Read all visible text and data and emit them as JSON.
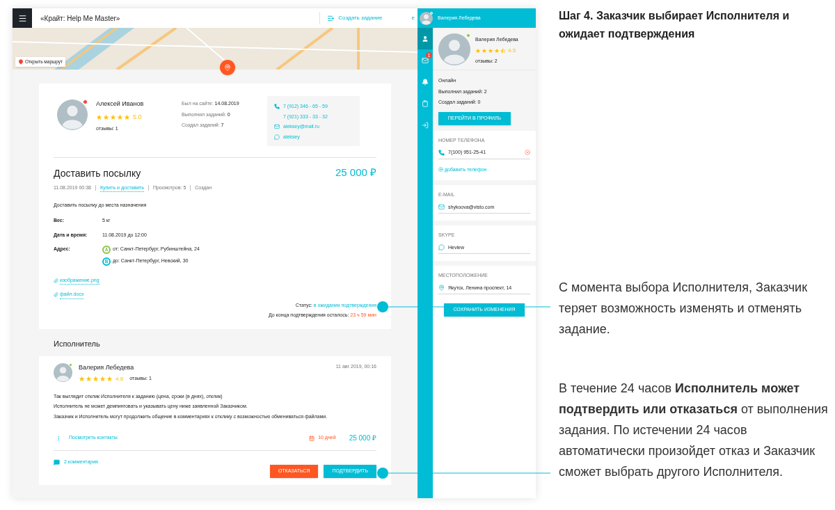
{
  "header": {
    "title": "«Крайт: Help Me Master»",
    "create_task": "Создать задание",
    "cut_link": "e"
  },
  "map": {
    "route_button": "Открыть маршрут"
  },
  "customer": {
    "name": "Алексей Иванов",
    "online": false,
    "stars": 5,
    "rating": "5.0",
    "reviews": "отзывы: 1",
    "stats": [
      {
        "label": "Был на сайте:",
        "value": "14.08.2019"
      },
      {
        "label": "Выполнил заданий:",
        "value": "0"
      },
      {
        "label": "Создал заданий:",
        "value": "7"
      }
    ],
    "phones": [
      "7 (912) 346 - 65 - 59",
      "7 (921) 333 - 33 - 32"
    ],
    "email": "aleksey@mall.ru",
    "skype": "aleksey"
  },
  "task": {
    "title": "Доставить посылку",
    "price": "25 000 ₽",
    "date": "11.08.2019 00:38",
    "category": "Купить и доставить",
    "views": "Просмотров: 5",
    "state": "Создан",
    "description": "Доставить посылку до места назначения",
    "details": [
      {
        "label": "Вес:",
        "value": "5 кг"
      },
      {
        "label": "Дата и время:",
        "value": "11.08.2019 до 12:00"
      }
    ],
    "address_label": "Адрес:",
    "addresses": [
      {
        "marker": "A",
        "text": "от: Санкт-Петербург, Рубинштейна, 24",
        "color": "#8bc34a"
      },
      {
        "marker": "B",
        "text": "до: Санкт-Петербург, Невский, 30",
        "color": "#00bcd4"
      }
    ],
    "attachments": [
      "изображение.png",
      "файл.docx"
    ],
    "status_label": "Статус:",
    "status_value": "в ожидании подтверждения",
    "remaining_label": "До конца подтверждения осталось:",
    "remaining_value": "23 ч 59 мин"
  },
  "executor_heading": "Исполнитель",
  "response": {
    "name": "Валерия Лебедева",
    "online": true,
    "stars": 5,
    "rating": "4.8",
    "reviews": "отзывы: 1",
    "date": "11 авг 2019, 00:16",
    "lines": [
      "Так выглядит отклик Исполнителя к заданию (цена, сроки (в днях), отклик)",
      "Исполнитель не может демпинговать и указывать цену ниже заявленной Заказчиком.",
      "Заказчик и Исполнитель могут продолжить общение в комментариях к отклику с возможностью обмениваться файлами."
    ],
    "contacts_link": "Посмотреть контакты",
    "days": "10 дней",
    "price": "25 000 ₽",
    "comments": "2 комментария",
    "buttons": [
      {
        "label": "ОТКАЗАТЬСЯ",
        "kind": "decline"
      },
      {
        "label": "ПОДТВЕРДИТЬ",
        "kind": "confirm"
      }
    ]
  },
  "drawer": {
    "header_name": "Валерия Лебедева",
    "nav": [
      {
        "kind": "user",
        "selected": true
      },
      {
        "kind": "mail",
        "selected": false,
        "badge": "1"
      },
      {
        "kind": "bell",
        "selected": false
      },
      {
        "kind": "clipboard",
        "selected": false
      },
      {
        "kind": "exit",
        "selected": false
      }
    ],
    "profile": {
      "name": "Валерия Лебедева",
      "online": true,
      "stars": 4.5,
      "rating": "4.5",
      "reviews": "отзывы: 2"
    },
    "info": [
      "Онлайн",
      "Выполнил заданий: 2",
      "Создал заданий: 0"
    ],
    "profile_button": "ПЕРЕЙТИ В ПРОФИЛЬ",
    "fields": [
      {
        "label": "НОМЕР ТЕЛЕФОНА",
        "value": "7(100) 951-25-41",
        "kind": "phone",
        "clearable": true,
        "add_link": "добавить телефон"
      },
      {
        "label": "E-MAIL",
        "value": "shykoova@visto.com",
        "kind": "email",
        "clearable": false
      },
      {
        "label": "SKYPE",
        "value": "Heview",
        "kind": "skype",
        "clearable": false
      },
      {
        "label": "МЕСТОПОЛОЖЕНИЕ",
        "value": "Якутск, Ленина проспект, 14",
        "kind": "location",
        "clearable": false
      }
    ],
    "save_button": "СОХРАНИТЬ ИЗМЕНЕНИЯ"
  },
  "annotations": {
    "heading": "Шаг 4. Заказчик выбирает Исполнителя и ожидает подтверждения",
    "notes": [
      "С момента выбора Исполнителя, Заказчик теряет возможность изменять и отменять задание.",
      "В течение 24 часов **Исполнитель может подтвердить или отказаться** от выполнения задания. По истечении 24 часов автоматически произойдет отказ и Заказчик сможет выбрать другого Исполнителя."
    ]
  }
}
